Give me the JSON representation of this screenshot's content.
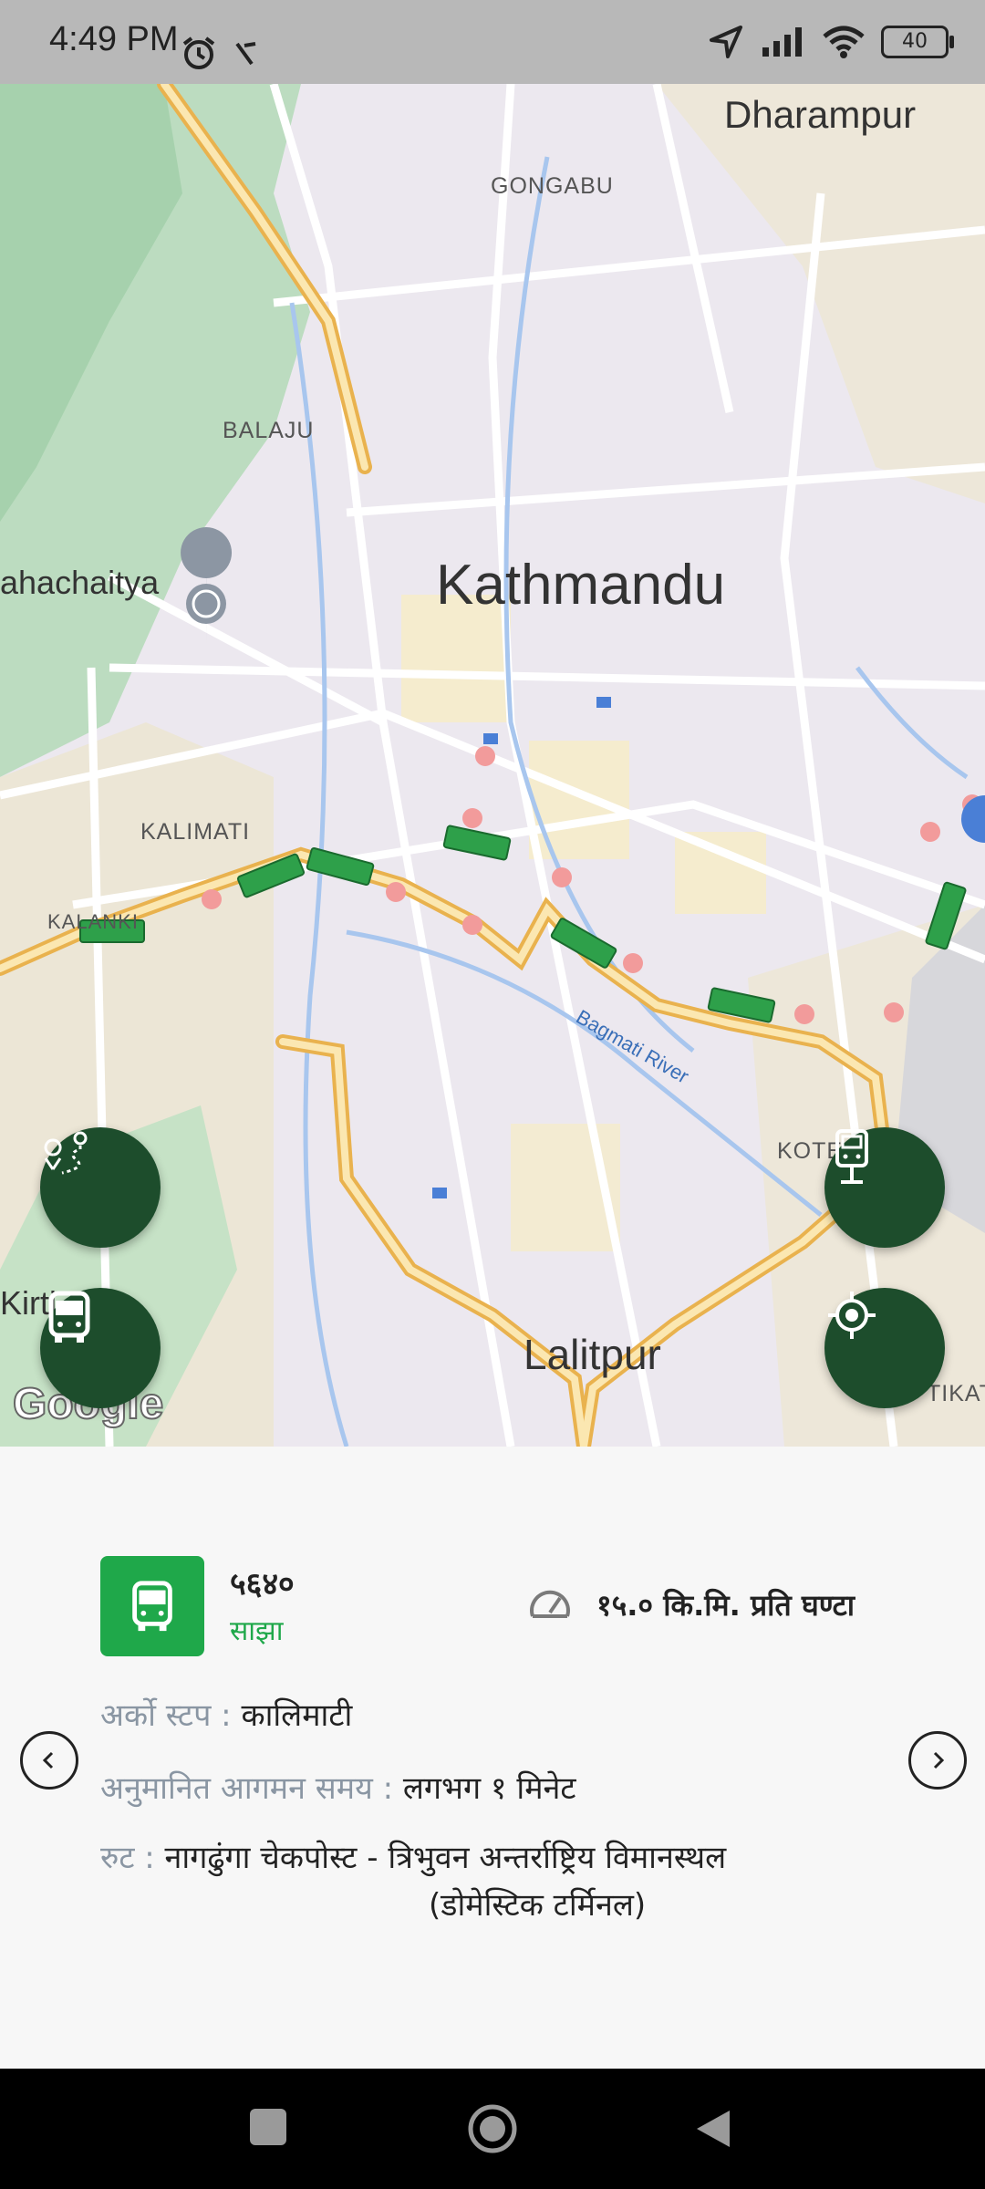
{
  "status_bar": {
    "time": "4:49 PM",
    "battery": "40",
    "icons": [
      "alarm-icon",
      "location-icon",
      "signal-icon",
      "wifi-icon",
      "battery-icon"
    ]
  },
  "map": {
    "labels": {
      "dharampur": "Dharampur",
      "gongabu": "GONGABU",
      "balaju": "BALAJU",
      "mahachaitya": "ahachaitya",
      "kathmandu": "Kathmandu",
      "kalimati": "KALIMATI",
      "kalanki": "KALANKI",
      "bagmati": "Bagmati River",
      "kotes": "KOTES",
      "kirti": "Kirti",
      "lalitpur": "Lalitpur",
      "tikati": "TIKATI",
      "google": "Google"
    },
    "colors": {
      "route": "#f0c46a",
      "bus": "#2ea04a",
      "stop": "#f29b9b",
      "fab": "#1d4d2c"
    }
  },
  "bus": {
    "number": "५६४०",
    "operator": "साझा",
    "speed": "१५.० कि.मि. प्रति घण्टा",
    "badge_color": "#1fa84a"
  },
  "details": {
    "next_stop_label": "अर्को स्टप :",
    "next_stop_value": "कालिमाटी",
    "eta_label": "अनुमानित आगमन समय :",
    "eta_value": "लगभग १ मिनेट",
    "route_label": "रुट :",
    "route_value": "नागढुंगा  चेकपोस्ट - त्रिभुवन अन्तर्राष्ट्रिय विमानस्थल",
    "route_value_cont": "(डोमेस्टिक टर्मिनल)"
  }
}
